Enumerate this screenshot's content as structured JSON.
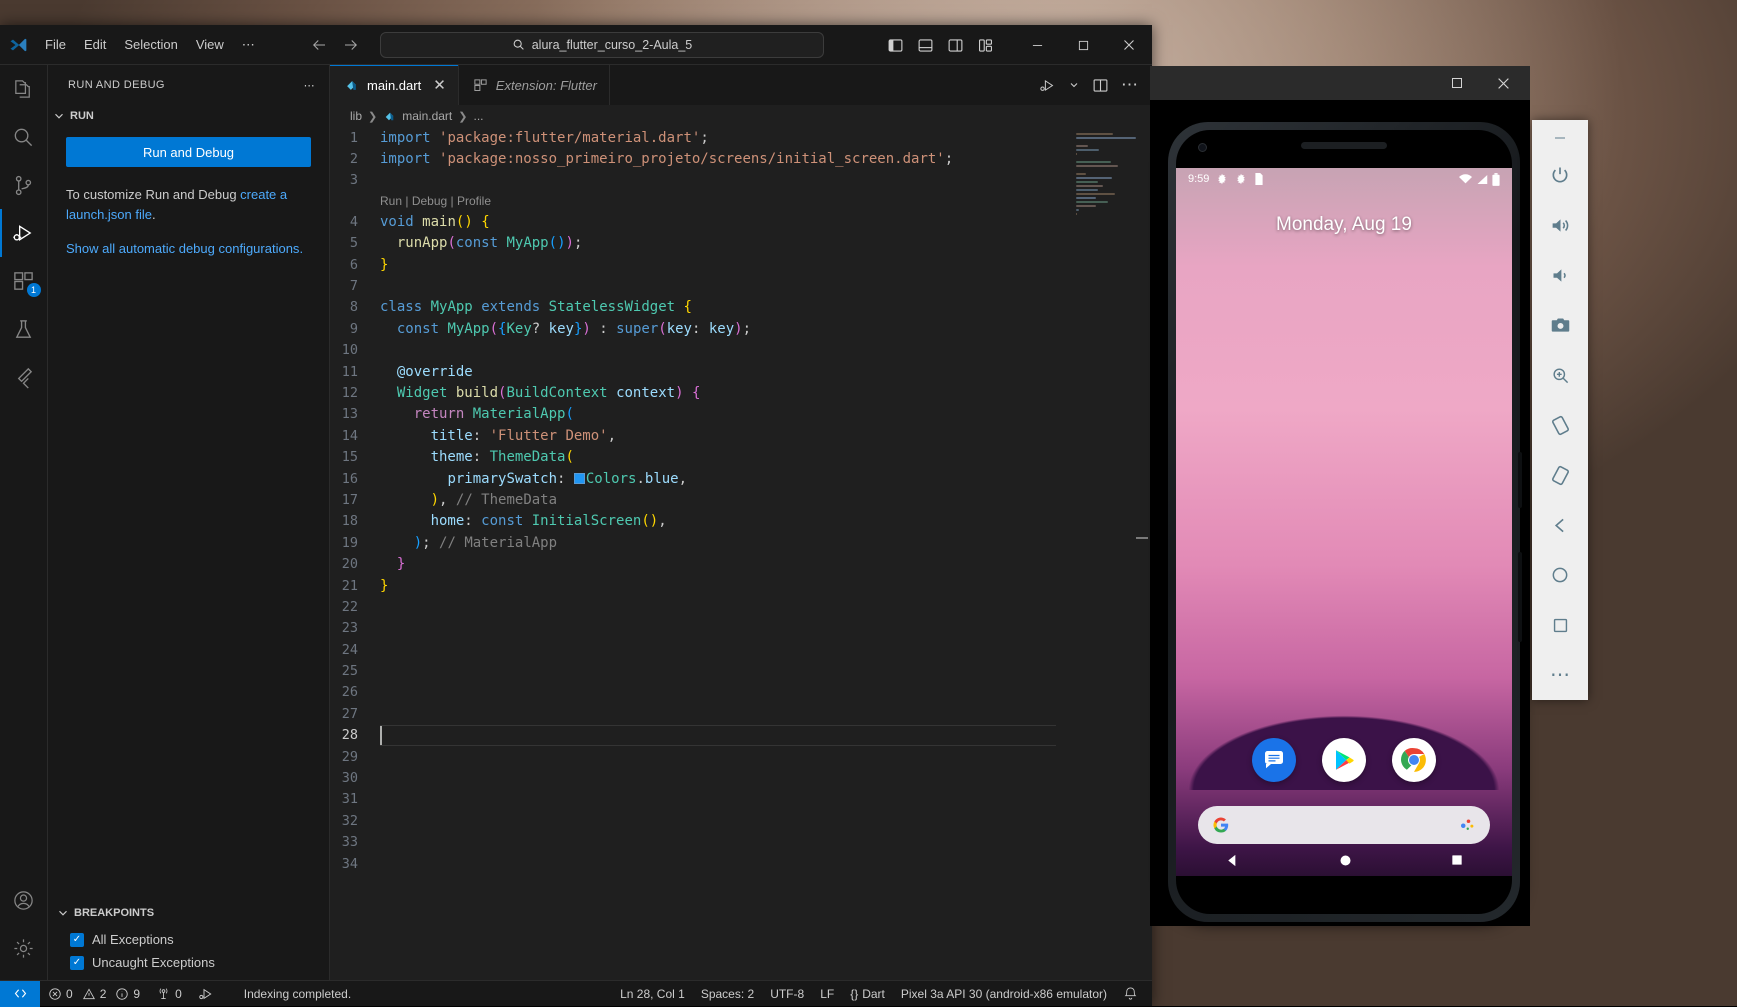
{
  "vscode": {
    "titlebar": {
      "menu": [
        "File",
        "Edit",
        "Selection",
        "View",
        "⋯"
      ],
      "command_center_text": "alura_flutter_curso_2-Aula_5",
      "nav_back": "←",
      "nav_forward": "→",
      "layout_icons": [
        "toggle-primary-sidebar",
        "toggle-panel",
        "toggle-secondary-sidebar",
        "customize-layout"
      ],
      "window_buttons": [
        "minimize",
        "maximize",
        "close"
      ]
    },
    "activitybar": {
      "items": [
        {
          "name": "explorer",
          "icon": "files-icon"
        },
        {
          "name": "search",
          "icon": "search-icon"
        },
        {
          "name": "source-control",
          "icon": "source-control-icon"
        },
        {
          "name": "run-and-debug",
          "icon": "run-debug-icon",
          "active": true
        },
        {
          "name": "extensions",
          "icon": "extensions-icon",
          "badge": "1"
        },
        {
          "name": "testing",
          "icon": "beaker-icon"
        },
        {
          "name": "flutter",
          "icon": "flutter-icon"
        }
      ],
      "bottom_items": [
        {
          "name": "accounts",
          "icon": "account-icon"
        },
        {
          "name": "settings",
          "icon": "gear-icon"
        }
      ]
    },
    "sidebar": {
      "title": "RUN AND DEBUG",
      "more_actions": "⋯",
      "section_run": "RUN",
      "run_button": "Run and Debug",
      "hint_before_link": "To customize Run and Debug ",
      "hint_link": "create a launch.json file",
      "hint_after_link": ".",
      "automatic_link": "Show all automatic debug configurations",
      "automatic_link_suffix": ".",
      "breakpoints_title": "BREAKPOINTS",
      "breakpoints": [
        {
          "label": "All Exceptions",
          "checked": true
        },
        {
          "label": "Uncaught Exceptions",
          "checked": true
        }
      ]
    },
    "tabs": [
      {
        "label": "main.dart",
        "icon": "dart-file-icon",
        "active": true,
        "closable": true,
        "preview": false
      },
      {
        "label": "Extension: Flutter",
        "icon": "extensions-icon",
        "active": false,
        "closable": false,
        "preview": true
      }
    ],
    "tab_actions": [
      "run-or-debug-icon",
      "chevron-down-icon",
      "split-editor-icon",
      "more-actions-icon"
    ],
    "breadcrumbs": [
      "lib",
      "main.dart",
      "..."
    ],
    "editor": {
      "cursor_position": "Ln 28, Col 1",
      "lines": [
        {
          "n": 1,
          "tokens": [
            {
              "t": "import",
              "c": "t-kw"
            },
            {
              "t": " ",
              "c": "t-punc"
            },
            {
              "t": "'package:flutter/material.dart'",
              "c": "t-str"
            },
            {
              "t": ";",
              "c": "t-punc"
            }
          ]
        },
        {
          "n": 2,
          "tokens": [
            {
              "t": "import",
              "c": "t-kw"
            },
            {
              "t": " ",
              "c": "t-punc"
            },
            {
              "t": "'package:nosso_primeiro_projeto/screens/initial_screen.dart'",
              "c": "t-str"
            },
            {
              "t": ";",
              "c": "t-punc"
            }
          ]
        },
        {
          "n": 3,
          "tokens": []
        },
        {
          "n": 4,
          "codelens": "Run | Debug | Profile",
          "tokens": [
            {
              "t": "void",
              "c": "t-kw"
            },
            {
              "t": " ",
              "c": "t-punc"
            },
            {
              "t": "main",
              "c": "t-fn"
            },
            {
              "t": "(",
              "c": "t-p1"
            },
            {
              "t": ")",
              "c": "t-p1"
            },
            {
              "t": " ",
              "c": "t-punc"
            },
            {
              "t": "{",
              "c": "t-p1"
            }
          ]
        },
        {
          "n": 5,
          "tokens": [
            {
              "t": "  ",
              "c": "t-punc"
            },
            {
              "t": "runApp",
              "c": "t-fn"
            },
            {
              "t": "(",
              "c": "t-p2"
            },
            {
              "t": "const",
              "c": "t-kw"
            },
            {
              "t": " ",
              "c": "t-punc"
            },
            {
              "t": "MyApp",
              "c": "t-type"
            },
            {
              "t": "(",
              "c": "t-p3"
            },
            {
              "t": ")",
              "c": "t-p3"
            },
            {
              "t": ")",
              "c": "t-p2"
            },
            {
              "t": ";",
              "c": "t-punc"
            }
          ]
        },
        {
          "n": 6,
          "tokens": [
            {
              "t": "}",
              "c": "t-p1"
            }
          ]
        },
        {
          "n": 7,
          "tokens": []
        },
        {
          "n": 8,
          "tokens": [
            {
              "t": "class",
              "c": "t-kw"
            },
            {
              "t": " ",
              "c": "t-punc"
            },
            {
              "t": "MyApp",
              "c": "t-type"
            },
            {
              "t": " ",
              "c": "t-punc"
            },
            {
              "t": "extends",
              "c": "t-kw"
            },
            {
              "t": " ",
              "c": "t-punc"
            },
            {
              "t": "StatelessWidget",
              "c": "t-type"
            },
            {
              "t": " ",
              "c": "t-punc"
            },
            {
              "t": "{",
              "c": "t-p1"
            }
          ]
        },
        {
          "n": 9,
          "tokens": [
            {
              "t": "  ",
              "c": "t-punc"
            },
            {
              "t": "const",
              "c": "t-kw"
            },
            {
              "t": " ",
              "c": "t-punc"
            },
            {
              "t": "MyApp",
              "c": "t-type"
            },
            {
              "t": "(",
              "c": "t-p2"
            },
            {
              "t": "{",
              "c": "t-p3"
            },
            {
              "t": "Key",
              "c": "t-type"
            },
            {
              "t": "? ",
              "c": "t-punc"
            },
            {
              "t": "key",
              "c": "t-var"
            },
            {
              "t": "}",
              "c": "t-p3"
            },
            {
              "t": ")",
              "c": "t-p2"
            },
            {
              "t": " : ",
              "c": "t-punc"
            },
            {
              "t": "super",
              "c": "t-kw"
            },
            {
              "t": "(",
              "c": "t-p2"
            },
            {
              "t": "key",
              "c": "t-var"
            },
            {
              "t": ": ",
              "c": "t-punc"
            },
            {
              "t": "key",
              "c": "t-var"
            },
            {
              "t": ")",
              "c": "t-p2"
            },
            {
              "t": ";",
              "c": "t-punc"
            }
          ]
        },
        {
          "n": 10,
          "tokens": []
        },
        {
          "n": 11,
          "tokens": [
            {
              "t": "  ",
              "c": "t-punc"
            },
            {
              "t": "@override",
              "c": "t-anno"
            }
          ]
        },
        {
          "n": 12,
          "tokens": [
            {
              "t": "  ",
              "c": "t-punc"
            },
            {
              "t": "Widget",
              "c": "t-type"
            },
            {
              "t": " ",
              "c": "t-punc"
            },
            {
              "t": "build",
              "c": "t-fn"
            },
            {
              "t": "(",
              "c": "t-p2"
            },
            {
              "t": "BuildContext",
              "c": "t-type"
            },
            {
              "t": " ",
              "c": "t-punc"
            },
            {
              "t": "context",
              "c": "t-var"
            },
            {
              "t": ")",
              "c": "t-p2"
            },
            {
              "t": " ",
              "c": "t-punc"
            },
            {
              "t": "{",
              "c": "t-p2"
            }
          ]
        },
        {
          "n": 13,
          "tokens": [
            {
              "t": "    ",
              "c": "t-punc"
            },
            {
              "t": "return",
              "c": "t-kw2"
            },
            {
              "t": " ",
              "c": "t-punc"
            },
            {
              "t": "MaterialApp",
              "c": "t-type"
            },
            {
              "t": "(",
              "c": "t-p3"
            }
          ]
        },
        {
          "n": 14,
          "tokens": [
            {
              "t": "      ",
              "c": "t-punc"
            },
            {
              "t": "title",
              "c": "t-var"
            },
            {
              "t": ": ",
              "c": "t-punc"
            },
            {
              "t": "'Flutter Demo'",
              "c": "t-str"
            },
            {
              "t": ",",
              "c": "t-punc"
            }
          ]
        },
        {
          "n": 15,
          "tokens": [
            {
              "t": "      ",
              "c": "t-punc"
            },
            {
              "t": "theme",
              "c": "t-var"
            },
            {
              "t": ": ",
              "c": "t-punc"
            },
            {
              "t": "ThemeData",
              "c": "t-type"
            },
            {
              "t": "(",
              "c": "t-p1"
            }
          ]
        },
        {
          "n": 16,
          "swatch": "#2196f3",
          "tokens": [
            {
              "t": "        ",
              "c": "t-punc"
            },
            {
              "t": "primarySwatch",
              "c": "t-var"
            },
            {
              "t": ": ",
              "c": "t-punc"
            },
            {
              "t": "SWATCH",
              "c": "swatch"
            },
            {
              "t": "Colors",
              "c": "t-type"
            },
            {
              "t": ".",
              "c": "t-punc"
            },
            {
              "t": "blue",
              "c": "t-var"
            },
            {
              "t": ",",
              "c": "t-punc"
            }
          ]
        },
        {
          "n": 17,
          "tokens": [
            {
              "t": "      ",
              "c": "t-punc"
            },
            {
              "t": ")",
              "c": "t-p1"
            },
            {
              "t": ",",
              "c": "t-punc"
            },
            {
              "t": " ",
              "c": "t-punc"
            },
            {
              "t": "// ThemeData",
              "c": "t-dim"
            }
          ]
        },
        {
          "n": 18,
          "tokens": [
            {
              "t": "      ",
              "c": "t-punc"
            },
            {
              "t": "home",
              "c": "t-var"
            },
            {
              "t": ": ",
              "c": "t-punc"
            },
            {
              "t": "const",
              "c": "t-kw"
            },
            {
              "t": " ",
              "c": "t-punc"
            },
            {
              "t": "InitialScreen",
              "c": "t-type"
            },
            {
              "t": "(",
              "c": "t-p1"
            },
            {
              "t": ")",
              "c": "t-p1"
            },
            {
              "t": ",",
              "c": "t-punc"
            }
          ]
        },
        {
          "n": 19,
          "tokens": [
            {
              "t": "    ",
              "c": "t-punc"
            },
            {
              "t": ")",
              "c": "t-p3"
            },
            {
              "t": ";",
              "c": "t-punc"
            },
            {
              "t": " ",
              "c": "t-punc"
            },
            {
              "t": "// MaterialApp",
              "c": "t-dim"
            }
          ]
        },
        {
          "n": 20,
          "tokens": [
            {
              "t": "  ",
              "c": "t-punc"
            },
            {
              "t": "}",
              "c": "t-p2"
            }
          ]
        },
        {
          "n": 21,
          "tokens": [
            {
              "t": "}",
              "c": "t-p1"
            }
          ]
        },
        {
          "n": 22,
          "tokens": []
        },
        {
          "n": 23,
          "tokens": []
        },
        {
          "n": 24,
          "tokens": []
        },
        {
          "n": 25,
          "tokens": []
        },
        {
          "n": 26,
          "tokens": []
        },
        {
          "n": 27,
          "tokens": []
        },
        {
          "n": 28,
          "tokens": [],
          "cursor": true,
          "current": true
        },
        {
          "n": 29,
          "tokens": []
        },
        {
          "n": 30,
          "tokens": []
        },
        {
          "n": 31,
          "tokens": []
        },
        {
          "n": 32,
          "tokens": []
        },
        {
          "n": 33,
          "tokens": []
        },
        {
          "n": 34,
          "tokens": []
        }
      ]
    },
    "statusbar": {
      "remote_icon": "remote-window-icon",
      "errors": "0",
      "warnings": "2",
      "infos": "9",
      "ports": "0",
      "debug_icon": "debug-icon",
      "message": "Indexing completed.",
      "cursor": "Ln 28, Col 1",
      "indent": "Spaces: 2",
      "encoding": "UTF-8",
      "eol": "LF",
      "language": "Dart",
      "device": "Pixel 3a API 30 (android-x86 emulator)",
      "bell": "notifications-icon"
    }
  },
  "emulator": {
    "window_buttons": [
      "maximize",
      "close"
    ],
    "status": {
      "time": "9:59",
      "icons": [
        "settings-icon",
        "settings-icon",
        "sim-card-icon"
      ],
      "right_icons": [
        "wifi-icon",
        "signal-icon",
        "battery-icon"
      ]
    },
    "date": "Monday, Aug 19",
    "dock_apps": [
      "messages-app-icon",
      "play-store-app-icon",
      "chrome-app-icon"
    ],
    "search": {
      "left_icon": "google-g-icon",
      "right_icon": "google-assistant-icon"
    },
    "nav": [
      "back-nav-icon",
      "home-nav-icon",
      "recents-nav-icon"
    ],
    "toolbar": [
      {
        "name": "minimize",
        "icon": "minimize-icon"
      },
      {
        "name": "power",
        "icon": "power-icon"
      },
      {
        "name": "volume-up",
        "icon": "volume-up-icon"
      },
      {
        "name": "volume-down",
        "icon": "volume-down-icon"
      },
      {
        "name": "screenshot",
        "icon": "camera-icon"
      },
      {
        "name": "zoom",
        "icon": "zoom-in-icon"
      },
      {
        "name": "rotate-left",
        "icon": "rotate-left-icon"
      },
      {
        "name": "rotate-right",
        "icon": "rotate-right-icon"
      },
      {
        "name": "back",
        "icon": "back-icon"
      },
      {
        "name": "home",
        "icon": "home-circle-icon"
      },
      {
        "name": "overview",
        "icon": "square-icon"
      },
      {
        "name": "more",
        "icon": "more-icon"
      }
    ]
  }
}
